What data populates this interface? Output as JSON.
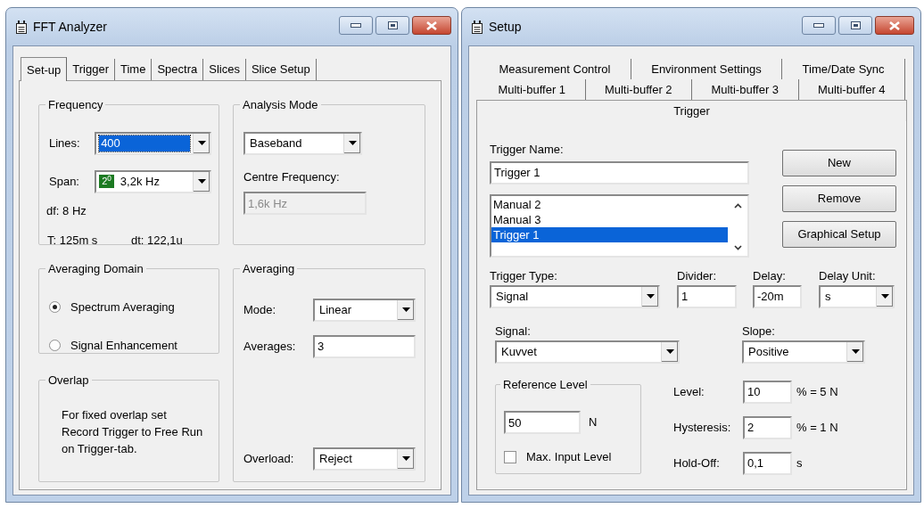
{
  "fft_analyzer": {
    "title": "FFT Analyzer",
    "tabs": [
      {
        "label": "Set-up",
        "selected": true
      },
      {
        "label": "Trigger",
        "selected": false
      },
      {
        "label": "Time",
        "selected": false
      },
      {
        "label": "Spectra",
        "selected": false
      },
      {
        "label": "Slices",
        "selected": false
      },
      {
        "label": "Slice Setup",
        "selected": false
      }
    ],
    "frequency": {
      "title": "Frequency",
      "lines": {
        "label": "Lines:",
        "kind": "combo",
        "value": "400",
        "focused": true
      },
      "span": {
        "label": "Span:",
        "kind": "combo",
        "badge": "2$^{0}$",
        "value": "3,2k Hz",
        "focused": false
      },
      "df": "df: 8 Hz",
      "t": "T: 125m s",
      "dt": "dt: 122,1u"
    },
    "analysis_mode": {
      "title": "Analysis Mode",
      "mode": {
        "kind": "combo",
        "value": "Baseband"
      },
      "centre_frequency": {
        "label": "Centre Frequency:",
        "kind": "edit",
        "value": "1,6k Hz",
        "disabled": true
      }
    },
    "averaging_domain": {
      "title": "Averaging Domain",
      "options": [
        {
          "label": "Spectrum Averaging",
          "selected": true
        },
        {
          "label": "Signal Enhancement",
          "selected": false
        }
      ]
    },
    "overlap": {
      "title": "Overlap",
      "text": "For fixed overlap set Record Trigger to Free Run on Trigger-tab."
    },
    "averaging": {
      "title": "Averaging",
      "mode": {
        "label": "Mode:",
        "kind": "combo",
        "value": "Linear"
      },
      "averages": {
        "label": "Averages:",
        "kind": "edit",
        "value": "3"
      },
      "overload": {
        "label": "Overload:",
        "kind": "combo",
        "value": "Reject"
      }
    }
  },
  "setup": {
    "title": "Setup",
    "tab_rows": [
      [
        {
          "label": "Measurement Control",
          "selected": false
        },
        {
          "label": "Environment Settings",
          "selected": false
        },
        {
          "label": "Time/Date Sync",
          "selected": false
        }
      ],
      [
        {
          "label": "Multi-buffer 1",
          "selected": false
        },
        {
          "label": "Multi-buffer 2",
          "selected": false
        },
        {
          "label": "Multi-buffer 3",
          "selected": false
        },
        {
          "label": "Multi-buffer 4",
          "selected": false
        }
      ],
      [
        {
          "label": "Trigger",
          "selected": true
        }
      ]
    ],
    "trigger_name": {
      "label": "Trigger Name:",
      "kind": "edit",
      "value": "Trigger 1"
    },
    "triggers": [
      {
        "label": "Manual 2",
        "selected": false
      },
      {
        "label": "Manual 3",
        "selected": false
      },
      {
        "label": "Trigger 1",
        "selected": true
      }
    ],
    "buttons": [
      "New",
      "Remove",
      "Graphical Setup"
    ],
    "trigger_type": {
      "label": "Trigger Type:",
      "kind": "combo",
      "value": "Signal"
    },
    "divider": {
      "label": "Divider:",
      "kind": "edit",
      "value": "1"
    },
    "delay": {
      "label": "Delay:",
      "kind": "edit",
      "value": "-20m"
    },
    "delay_unit": {
      "label": "Delay Unit:",
      "kind": "combo",
      "value": "s"
    },
    "signal": {
      "label": "Signal:",
      "kind": "combo",
      "value": "Kuvvet"
    },
    "slope": {
      "label": "Slope:",
      "kind": "combo",
      "value": "Positive"
    },
    "reference_level": {
      "title": "Reference Level",
      "field": {
        "kind": "edit",
        "value": "50"
      },
      "unit": "N",
      "max_input_level": {
        "label": "Max. Input Level",
        "checked": false
      }
    },
    "level": {
      "label": "Level:",
      "kind": "edit",
      "value": "10",
      "note": "% = 5 N"
    },
    "hysteresis": {
      "label": "Hysteresis:",
      "kind": "edit",
      "value": "2",
      "note": "% = 1 N"
    },
    "hold_off": {
      "label": "Hold-Off:",
      "kind": "edit",
      "value": "0,1",
      "note": "s"
    }
  }
}
